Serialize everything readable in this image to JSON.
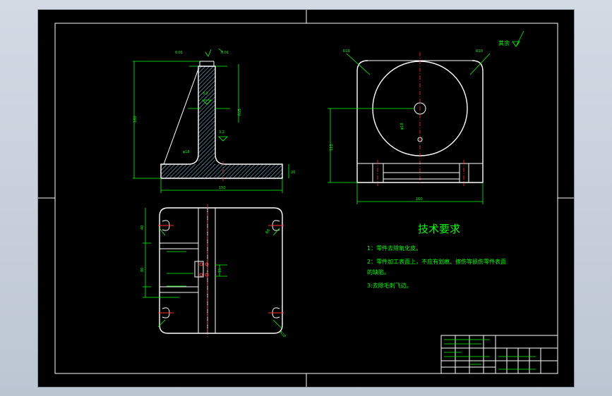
{
  "roughness_note": "其余",
  "tech_requirements": {
    "title": "技术要求",
    "items": [
      "1：零件去除氧化皮。",
      "2：零件加工表面上，不应有划痕、擦伤等损伤零件表面",
      "的缺陷。",
      "3:去除毛刺飞边。"
    ]
  },
  "colors": {
    "background": "#000000",
    "outline": "#ffffff",
    "dimension": "#00ff00",
    "centerline": "#ff3030",
    "window": "#c5cdd8"
  }
}
